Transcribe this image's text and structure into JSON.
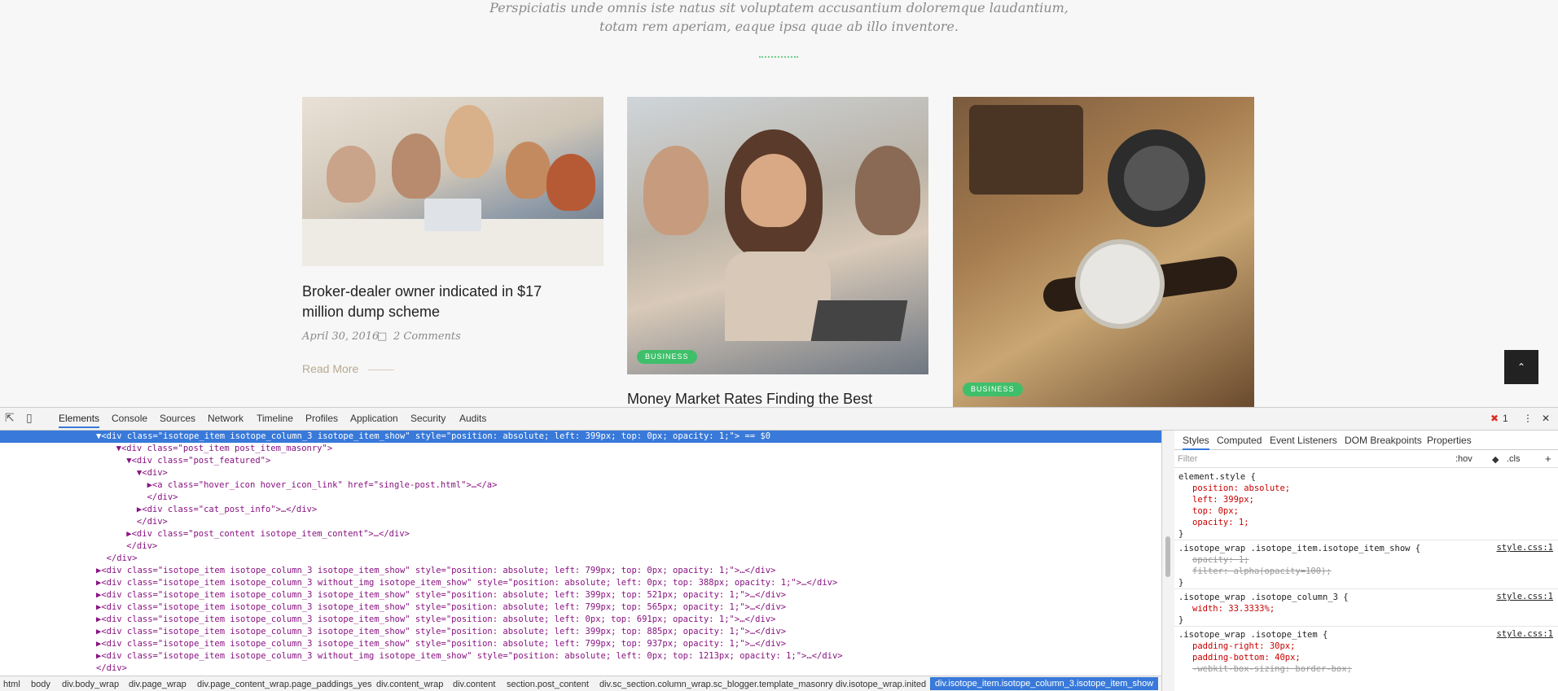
{
  "site": {
    "subtitle_line1": "Perspiciatis unde omnis iste natus sit voluptatem accusantium doloremque laudantium,",
    "subtitle_line2": "totam rem aperiam, eaque ipsa quae ab illo inventore.",
    "posts": [
      {
        "title_line1": "Broker-dealer owner indicated in $17",
        "title_line2": "million dump scheme",
        "date": "April 30, 2016",
        "comments": "2 Comments",
        "read_more": "Read More"
      },
      {
        "badge": "BUSINESS",
        "title_line1": "Money Market Rates Finding the Best"
      },
      {
        "badge": "BUSINESS"
      }
    ],
    "to_top_icon": "chevron-up-icon"
  },
  "devtools": {
    "tabs": [
      "Elements",
      "Console",
      "Sources",
      "Network",
      "Timeline",
      "Profiles",
      "Application",
      "Security",
      "Audits"
    ],
    "error_count": "1",
    "dom_lines": [
      {
        "text": "▼<div class=\"isotope_item isotope_column_3 isotope_item_show\" style=\"position: absolute; left: 399px; top: 0px; opacity: 1;\"> == $0"
      },
      {
        "text": "  ▼<div class=\"post_item post_item_masonry\">"
      },
      {
        "text": "    ▼<div class=\"post_featured\">"
      },
      {
        "text": "      ▼<div>"
      },
      {
        "text": "        ▶<a class=\"hover_icon hover_icon_link\" href=\"single-post.html\">…</a>"
      },
      {
        "text": "        </div>"
      },
      {
        "text": "      ▶<div class=\"cat_post_info\">…</div>"
      },
      {
        "text": "      </div>"
      },
      {
        "text": "    ▶<div class=\"post_content isotope_item_content\">…</div>"
      },
      {
        "text": "    </div>"
      },
      {
        "text": "  </div>"
      },
      {
        "text": "▶<div class=\"isotope_item isotope_column_3 isotope_item_show\" style=\"position: absolute; left: 799px; top: 0px; opacity: 1;\">…</div>"
      },
      {
        "text": "▶<div class=\"isotope_item isotope_column_3 without_img isotope_item_show\" style=\"position: absolute; left: 0px; top: 388px; opacity: 1;\">…</div>"
      },
      {
        "text": "▶<div class=\"isotope_item isotope_column_3 isotope_item_show\" style=\"position: absolute; left: 399px; top: 521px; opacity: 1;\">…</div>"
      },
      {
        "text": "▶<div class=\"isotope_item isotope_column_3 isotope_item_show\" style=\"position: absolute; left: 799px; top: 565px; opacity: 1;\">…</div>"
      },
      {
        "text": "▶<div class=\"isotope_item isotope_column_3 isotope_item_show\" style=\"position: absolute; left: 0px; top: 691px; opacity: 1;\">…</div>"
      },
      {
        "text": "▶<div class=\"isotope_item isotope_column_3 isotope_item_show\" style=\"position: absolute; left: 399px; top: 885px; opacity: 1;\">…</div>"
      },
      {
        "text": "▶<div class=\"isotope_item isotope_column_3 isotope_item_show\" style=\"position: absolute; left: 799px; top: 937px; opacity: 1;\">…</div>"
      },
      {
        "text": "▶<div class=\"isotope_item isotope_column_3 without_img isotope_item_show\" style=\"position: absolute; left: 0px; top: 1213px; opacity: 1;\">…</div>"
      },
      {
        "text": "</div>"
      }
    ],
    "breadcrumbs": [
      "html",
      "body",
      "div.body_wrap",
      "div.page_wrap",
      "div.page_content_wrap.page_paddings_yes",
      "div.content_wrap",
      "div.content",
      "section.post_content",
      "div.sc_section.column_wrap.sc_blogger.template_masonry",
      "div.isotope_wrap.inited",
      "div.isotope_item.isotope_column_3.isotope_item_show"
    ],
    "styles_tabs": [
      "Styles",
      "Computed",
      "Event Listeners",
      "DOM Breakpoints",
      "Properties"
    ],
    "filter_placeholder": "Filter",
    "hov": ":hov",
    "cls": ".cls",
    "plus": "+",
    "rules": {
      "r0_sel": "element.style {",
      "r0_p1": "position: absolute;",
      "r0_p2": "left: 399px;",
      "r0_p3": "top: 0px;",
      "r0_p4": "opacity: 1;",
      "close": "}",
      "r1_sel": ".isotope_wrap .isotope_item.isotope_item_show {",
      "r1_src": "style.css:1",
      "r1_p1": "opacity: 1;",
      "r1_p2": "filter: alpha(opacity=100);",
      "r2_sel": ".isotope_wrap .isotope_column_3 {",
      "r2_src": "style.css:1",
      "r2_p1": "width: 33.3333%;",
      "r3_sel": ".isotope_wrap .isotope_item {",
      "r3_src": "style.css:1",
      "r3_p1": "padding-right: 30px;",
      "r3_p2": "padding-bottom: 40px;",
      "r3_p3": "-webkit-box-sizing: border-box;"
    }
  }
}
